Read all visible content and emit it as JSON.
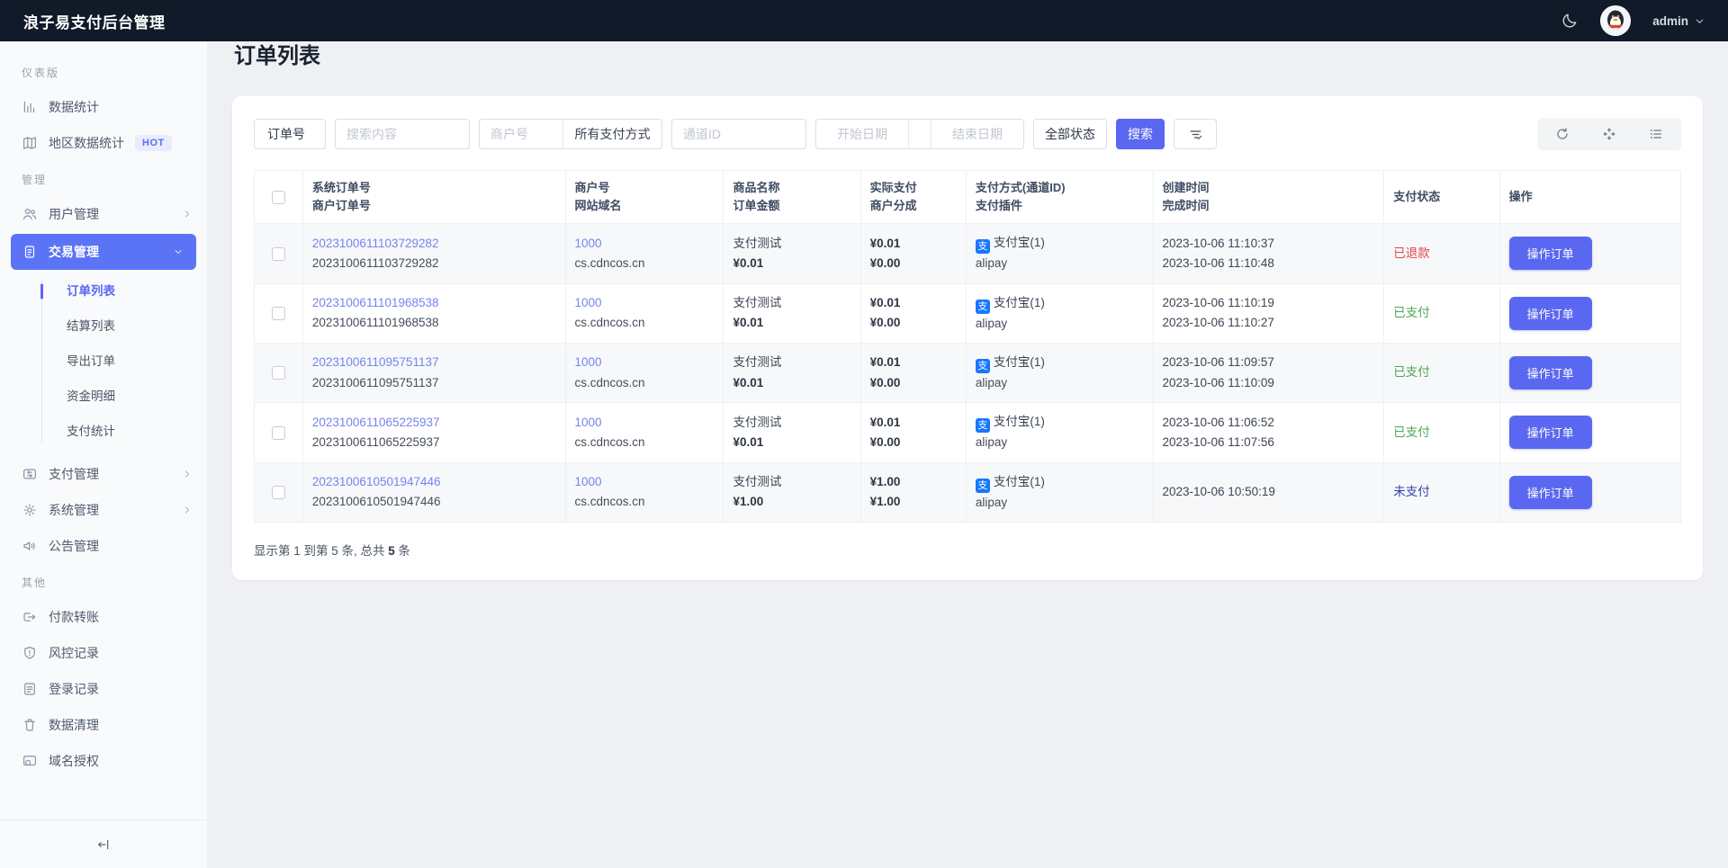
{
  "colors": {
    "accent": "#5a68f1",
    "sidebar_active_bg": "#5b74f6",
    "link": "#7683f0",
    "status_refunded": "#e5484d",
    "status_paid": "#4fa455",
    "status_unpaid": "#3642a5",
    "topbar_bg": "#101a29",
    "alipay_blue": "#1677ff"
  },
  "header": {
    "title": "浪子易支付后台管理",
    "user_label": "admin"
  },
  "sidebar": {
    "sections": [
      {
        "label": "仪表版",
        "items": [
          {
            "key": "data-stats",
            "label": "数据统计",
            "icon": "bar-chart-icon"
          },
          {
            "key": "region-stats",
            "label": "地区数据统计",
            "icon": "map-icon",
            "badge": "HOT"
          }
        ]
      },
      {
        "label": "管理",
        "items": [
          {
            "key": "user-mgmt",
            "label": "用户管理",
            "icon": "users-icon",
            "expandable": true
          },
          {
            "key": "trade-mgmt",
            "label": "交易管理",
            "icon": "document-icon",
            "expandable": true,
            "expanded": true,
            "active": true,
            "children": [
              {
                "key": "order-list",
                "label": "订单列表",
                "active": true
              },
              {
                "key": "settle-list",
                "label": "结算列表"
              },
              {
                "key": "export-orders",
                "label": "导出订单"
              },
              {
                "key": "fund-detail",
                "label": "资金明细"
              },
              {
                "key": "pay-stats",
                "label": "支付统计"
              }
            ]
          },
          {
            "key": "pay-mgmt",
            "label": "支付管理",
            "icon": "card-icon",
            "expandable": true
          },
          {
            "key": "system-mgmt",
            "label": "系统管理",
            "icon": "gear-icon",
            "expandable": true
          },
          {
            "key": "announcement-mgmt",
            "label": "公告管理",
            "icon": "speaker-icon"
          }
        ]
      },
      {
        "label": "其他",
        "items": [
          {
            "key": "payout-transfer",
            "label": "付款转账",
            "icon": "transfer-icon"
          },
          {
            "key": "risk-records",
            "label": "风控记录",
            "icon": "shield-icon"
          },
          {
            "key": "login-records",
            "label": "登录记录",
            "icon": "log-icon"
          },
          {
            "key": "data-cleanup",
            "label": "数据清理",
            "icon": "trash-icon"
          },
          {
            "key": "domain-auth",
            "label": "域名授权",
            "icon": "domain-icon"
          }
        ]
      }
    ]
  },
  "page": {
    "title": "订单列表"
  },
  "filters": {
    "order_field_select": "订单号",
    "search_placeholder": "搜索内容",
    "merchant_placeholder": "商户号",
    "pay_method_select": "所有支付方式",
    "channel_placeholder": "通道ID",
    "start_date_placeholder": "开始日期",
    "end_date_placeholder": "结束日期",
    "status_select": "全部状态",
    "search_button": "搜索"
  },
  "table": {
    "columns": [
      {
        "lines": [
          "系统订单号",
          "商户订单号"
        ]
      },
      {
        "lines": [
          "商户号",
          "网站域名"
        ]
      },
      {
        "lines": [
          "商品名称",
          "订单金额"
        ]
      },
      {
        "lines": [
          "实际支付",
          "商户分成"
        ]
      },
      {
        "lines": [
          "支付方式(通道ID)",
          "支付插件"
        ]
      },
      {
        "lines": [
          "创建时间",
          "完成时间"
        ]
      },
      {
        "lines": [
          "支付状态"
        ]
      },
      {
        "lines": [
          "操作"
        ]
      }
    ],
    "action_button": "操作订单",
    "rows": [
      {
        "system_order_no": "2023100611103729282",
        "merchant_order_no": "2023100611103729282",
        "merchant_id": "1000",
        "site_domain": "cs.cdncos.cn",
        "product_name": "支付测试",
        "order_amount": "¥0.01",
        "paid_amount": "¥0.01",
        "merchant_share": "¥0.00",
        "pay_method": "支付宝(1)",
        "pay_plugin": "alipay",
        "created_at": "2023-10-06 11:10:37",
        "completed_at": "2023-10-06 11:10:48",
        "status": "已退款",
        "status_type": "refunded"
      },
      {
        "system_order_no": "2023100611101968538",
        "merchant_order_no": "2023100611101968538",
        "merchant_id": "1000",
        "site_domain": "cs.cdncos.cn",
        "product_name": "支付测试",
        "order_amount": "¥0.01",
        "paid_amount": "¥0.01",
        "merchant_share": "¥0.00",
        "pay_method": "支付宝(1)",
        "pay_plugin": "alipay",
        "created_at": "2023-10-06 11:10:19",
        "completed_at": "2023-10-06 11:10:27",
        "status": "已支付",
        "status_type": "paid"
      },
      {
        "system_order_no": "2023100611095751137",
        "merchant_order_no": "2023100611095751137",
        "merchant_id": "1000",
        "site_domain": "cs.cdncos.cn",
        "product_name": "支付测试",
        "order_amount": "¥0.01",
        "paid_amount": "¥0.01",
        "merchant_share": "¥0.00",
        "pay_method": "支付宝(1)",
        "pay_plugin": "alipay",
        "created_at": "2023-10-06 11:09:57",
        "completed_at": "2023-10-06 11:10:09",
        "status": "已支付",
        "status_type": "paid"
      },
      {
        "system_order_no": "2023100611065225937",
        "merchant_order_no": "2023100611065225937",
        "merchant_id": "1000",
        "site_domain": "cs.cdncos.cn",
        "product_name": "支付测试",
        "order_amount": "¥0.01",
        "paid_amount": "¥0.01",
        "merchant_share": "¥0.00",
        "pay_method": "支付宝(1)",
        "pay_plugin": "alipay",
        "created_at": "2023-10-06 11:06:52",
        "completed_at": "2023-10-06 11:07:56",
        "status": "已支付",
        "status_type": "paid"
      },
      {
        "system_order_no": "2023100610501947446",
        "merchant_order_no": "2023100610501947446",
        "merchant_id": "1000",
        "site_domain": "cs.cdncos.cn",
        "product_name": "支付测试",
        "order_amount": "¥1.00",
        "paid_amount": "¥1.00",
        "merchant_share": "¥1.00",
        "pay_method": "支付宝(1)",
        "pay_plugin": "alipay",
        "created_at": "2023-10-06 10:50:19",
        "completed_at": "",
        "status": "未支付",
        "status_type": "unpaid"
      }
    ]
  },
  "summary": {
    "prefix": "显示第 1 到第 5 条, 总共 ",
    "total": "5",
    "suffix": " 条"
  }
}
